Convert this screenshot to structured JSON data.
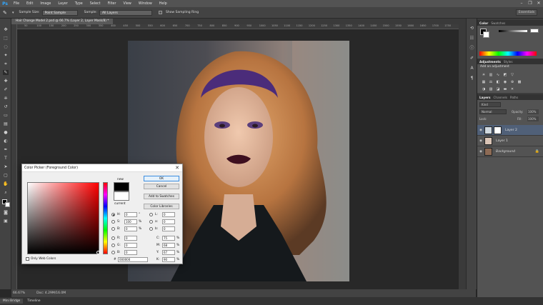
{
  "app": {
    "logo": "Ps",
    "menu": [
      "File",
      "Edit",
      "Image",
      "Layer",
      "Type",
      "Select",
      "Filter",
      "View",
      "Window",
      "Help"
    ],
    "window_controls": [
      "–",
      "❐",
      "✕"
    ]
  },
  "options_bar": {
    "tool_icon": "eyedropper-icon",
    "sample_size_label": "Sample Size:",
    "sample_size_value": "Point Sample",
    "sample_label": "Sample:",
    "sample_value": "All Layers",
    "show_ring_label": "Show Sampling Ring",
    "workspace": "Essentials"
  },
  "document": {
    "tab_title": "Hair Change Model 2.psd @ 66.7% (Layer 2, Layer Mask/8) *"
  },
  "ruler": {
    "ticks": [
      "50",
      "100",
      "150",
      "200",
      "250",
      "300",
      "350",
      "400",
      "450",
      "500",
      "550",
      "600",
      "650",
      "700",
      "750",
      "800",
      "850",
      "900",
      "950",
      "1000",
      "1050",
      "1100",
      "1150",
      "1200",
      "1250",
      "1300",
      "1350",
      "1400",
      "1450",
      "1500",
      "1550",
      "1600",
      "1650",
      "1700",
      "1750"
    ]
  },
  "status": {
    "zoom": "66.67%",
    "doc": "Doc: 4.29M/16.0M"
  },
  "bottom_tabs": [
    "Mini Bridge",
    "Timeline"
  ],
  "panels": {
    "color": {
      "tabs": [
        "Color",
        "Swatches"
      ]
    },
    "adjustments": {
      "tabs": [
        "Adjustments",
        "Styles"
      ],
      "hint": "Add an adjustment"
    },
    "layers": {
      "tabs": [
        "Layers",
        "Channels",
        "Paths"
      ],
      "kind_label": "Kind",
      "blend_mode": "Normal",
      "opacity_label": "Opacity:",
      "opacity_value": "100%",
      "lock_label": "Lock:",
      "fill_label": "Fill:",
      "fill_value": "100%",
      "items": [
        {
          "name": "Layer 2"
        },
        {
          "name": "Layer 1"
        },
        {
          "name": "Background"
        }
      ]
    }
  },
  "color_picker": {
    "title": "Color Picker (Foreground Color)",
    "new_label": "new",
    "current_label": "current",
    "ok": "OK",
    "cancel": "Cancel",
    "add_swatches": "Add to Swatches",
    "color_libraries": "Color Libraries",
    "only_web": "Only Web Colors",
    "hsb": {
      "H": "0",
      "S": "100",
      "B": "0"
    },
    "rgb": {
      "R": "0",
      "G": "0",
      "B": "0"
    },
    "lab": {
      "L": "0",
      "a": "0",
      "b": "0"
    },
    "cmyk": {
      "C": "75",
      "M": "68",
      "Y": "67",
      "K": "90"
    },
    "hex": "000000",
    "units": {
      "deg": "°",
      "pct": "%"
    },
    "labels": {
      "H": "H:",
      "S": "S:",
      "B": "B:",
      "R": "R:",
      "G": "G:",
      "B2": "B:",
      "L": "L:",
      "a": "a:",
      "b": "b:",
      "C": "C:",
      "M": "M:",
      "Y": "Y:",
      "K": "K:",
      "hash": "#"
    }
  },
  "colors": {
    "accent": "#31a8ff",
    "panel": "#535353",
    "bg": "#282828"
  }
}
